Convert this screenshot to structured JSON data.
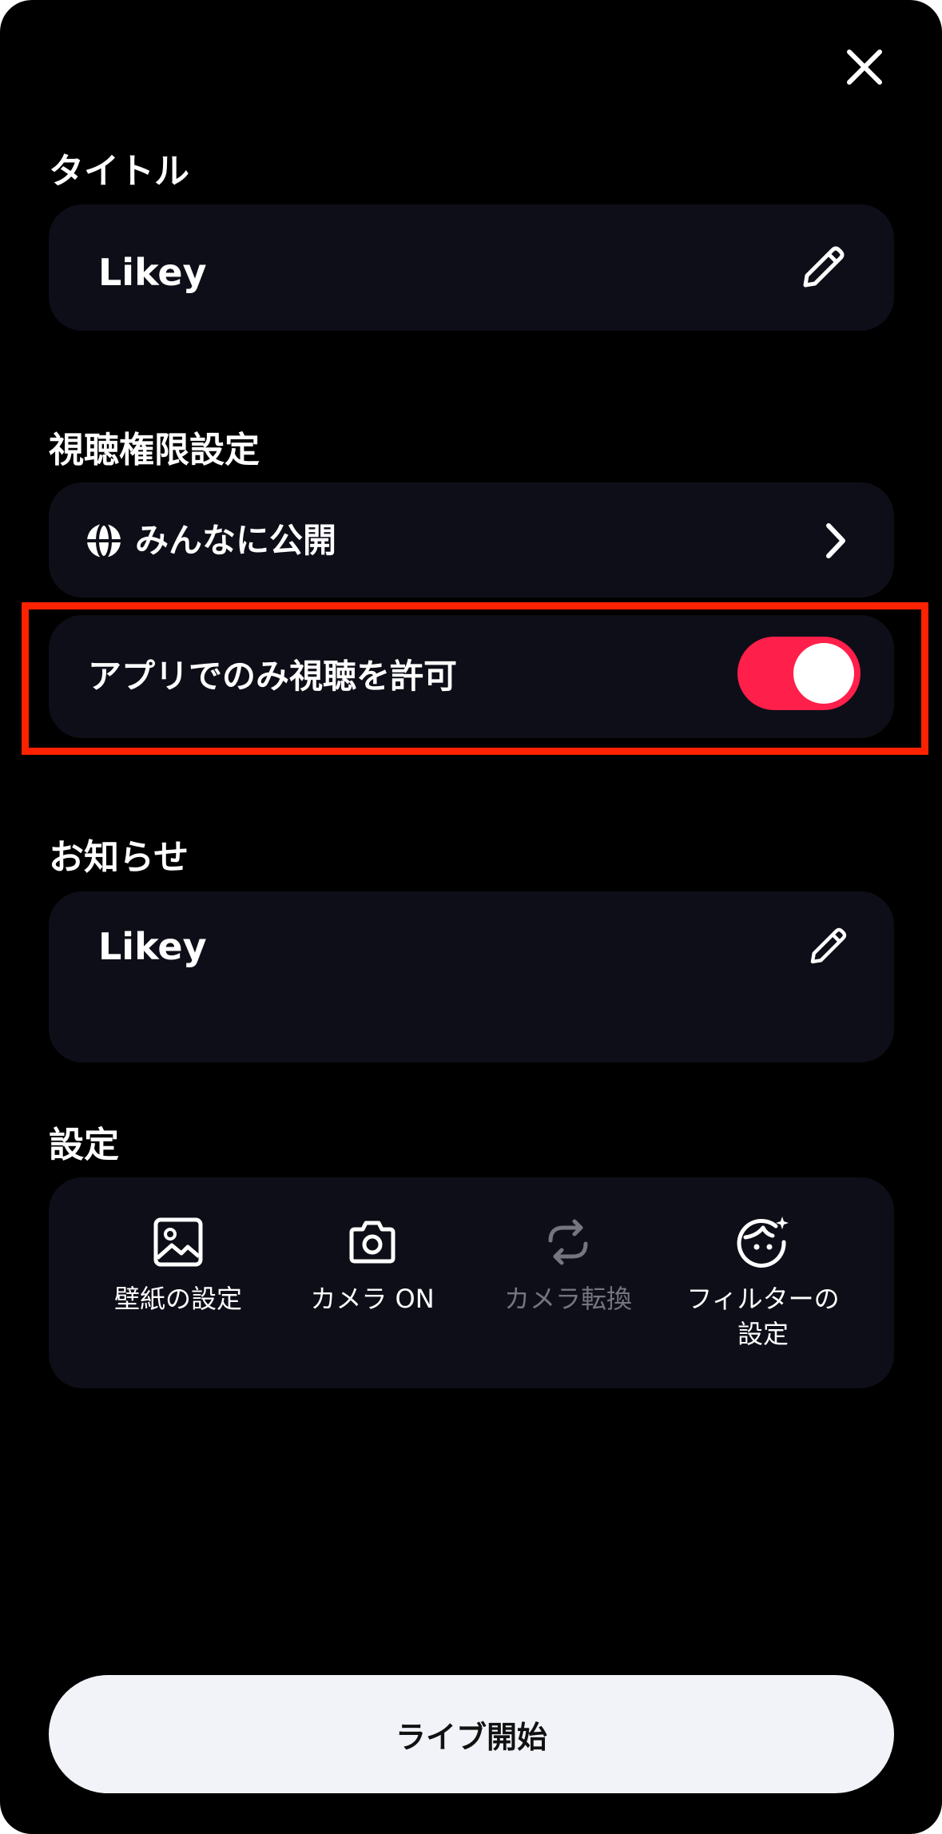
{
  "sections": {
    "title_label": "タイトル",
    "permission_label": "視聴権限設定",
    "notice_label": "お知らせ",
    "settings_label": "設定"
  },
  "title_field": {
    "value": "Likey",
    "icon": "pencil-icon"
  },
  "permission": {
    "value": "みんなに公開",
    "icon": "globe-icon",
    "chevron": "chevron-right-icon"
  },
  "app_only": {
    "label": "アプリでのみ視聴を許可",
    "enabled": true,
    "accent": "#ff1f4b",
    "highlight_color": "#ff2200"
  },
  "notice_field": {
    "value": "Likey",
    "icon": "pencil-icon"
  },
  "settings": [
    {
      "label": "壁紙の設定",
      "icon": "image-icon",
      "disabled": false
    },
    {
      "label": "カメラ ON",
      "icon": "camera-icon",
      "disabled": false
    },
    {
      "label": "カメラ転換",
      "icon": "camera-switch-icon",
      "disabled": true
    },
    {
      "label": "フィルターの\n設定",
      "icon": "face-sparkle-icon",
      "disabled": false
    }
  ],
  "start_button": {
    "label": "ライブ開始"
  },
  "colors": {
    "background": "#000000",
    "card": "#0e0e18",
    "button": "#f2f3f8"
  }
}
